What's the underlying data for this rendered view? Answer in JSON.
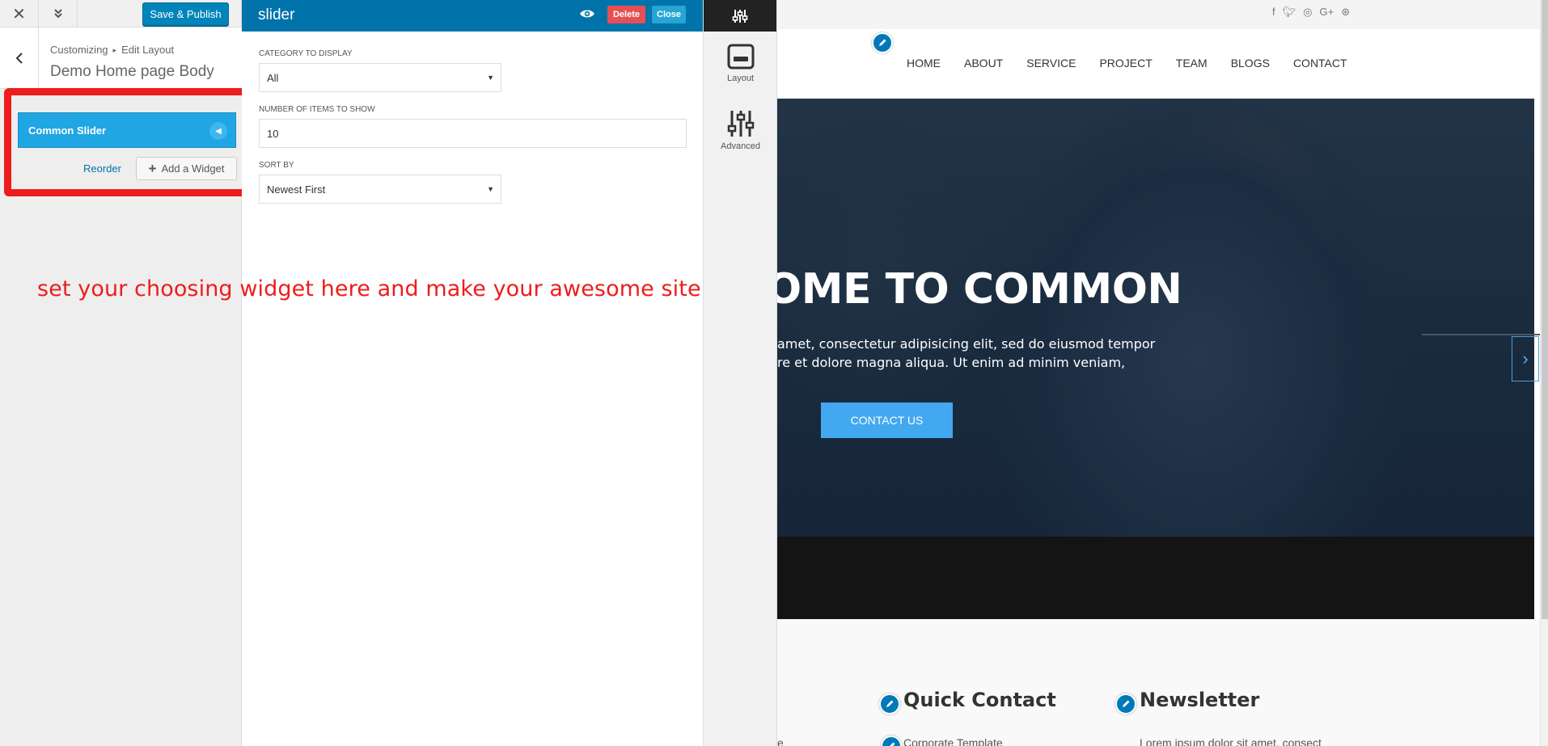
{
  "sidebar": {
    "save_publish_label": "Save & Publish",
    "breadcrumb": [
      "Customizing",
      "Edit Layout"
    ],
    "section_title": "Demo Home page Body",
    "widget_title": "Common Slider",
    "reorder_label": "Reorder",
    "add_widget_label": "Add a Widget"
  },
  "panel": {
    "title": "slider",
    "delete_label": "Delete",
    "close_label": "Close",
    "category_label": "CATEGORY TO DISPLAY",
    "category_value": "All",
    "items_label": "NUMBER OF ITEMS TO SHOW",
    "items_value": "10",
    "sort_label": "SORT BY",
    "sort_value": "Newest First"
  },
  "annotation": "set your choosing widget here and make your awesome site",
  "icon_column": {
    "layout_label": "Layout",
    "advanced_label": "Advanced"
  },
  "preview": {
    "nav": [
      "HOME",
      "ABOUT",
      "SERVICE",
      "PROJECT",
      "TEAM",
      "BLOGS",
      "CONTACT"
    ],
    "social_icons": [
      "facebook-icon",
      "twitter-icon",
      "instagram-icon",
      "google-plus-icon",
      "dribbble-icon"
    ],
    "hero_title": "OME TO COMMON",
    "hero_line1": "amet, consectetur adipisicing elit, sed do eiusmod tempor",
    "hero_line2": "re et dolore magna aliqua. Ut enim ad minim veniam,",
    "hero_button": "CONTACT US",
    "footer_quick_contact": "Quick Contact",
    "footer_newsletter": "Newsletter",
    "footer_corp": "Corporate Template",
    "footer_lorem": "Lorem ipsum dolor sit amet, consect",
    "footer_edge": "e"
  },
  "colors": {
    "annotation_red": "#ee1c1c",
    "wp_blue": "#0073aa",
    "widget_blue": "#20a6e2",
    "hero_button": "#42a8f0",
    "delete_red": "#e65054"
  }
}
